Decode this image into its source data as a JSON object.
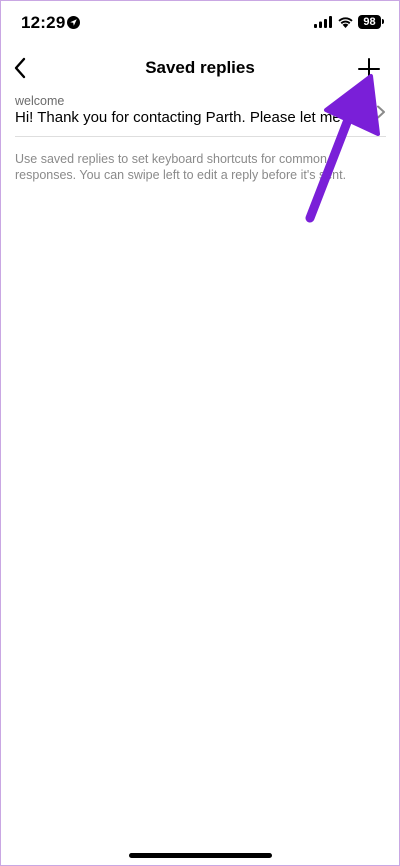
{
  "status_bar": {
    "time": "12:29",
    "battery": "98",
    "icons": [
      "location-icon",
      "signal-icon",
      "wifi-icon",
      "battery-icon"
    ]
  },
  "nav": {
    "title": "Saved replies",
    "back_icon": "chevron-left-icon",
    "add_icon": "plus-icon"
  },
  "replies": [
    {
      "shortcut": "welcome",
      "text": "Hi! Thank you for contacting Parth. Please let me know"
    }
  ],
  "footer_note": "Use saved replies to set keyboard shortcuts for common responses. You can swipe left to edit a reply before it's sent.",
  "colors": {
    "annotation_arrow": "#7a1fd8",
    "frame_border": "#c9a7e3",
    "secondary_text": "#8a8a8a"
  }
}
